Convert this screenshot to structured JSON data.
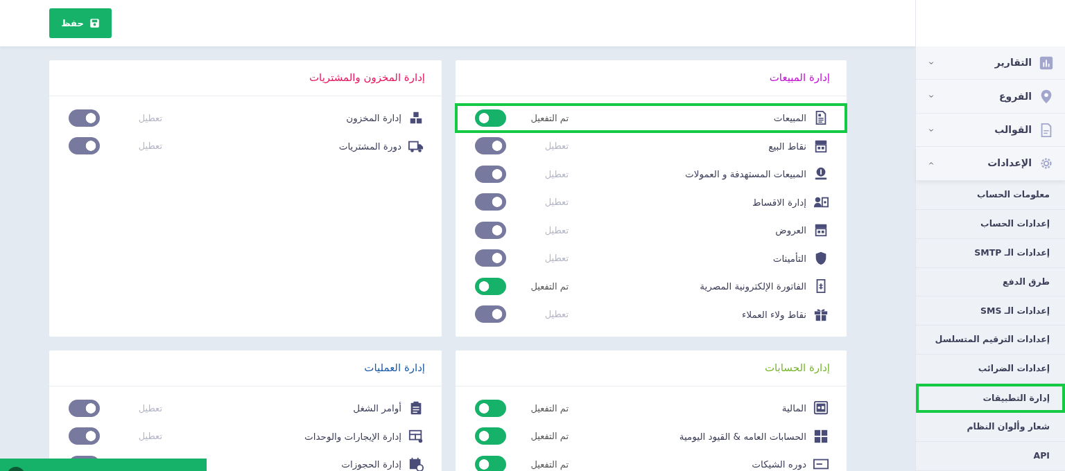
{
  "toolbar": {
    "save_button": "حفظ"
  },
  "sections": [
    {
      "title": "إدارة المبيعات",
      "color": "#c50fd6",
      "rows": [
        {
          "label": "المبيعات",
          "status": "تم التفعيل",
          "on": true,
          "highlighted": true
        },
        {
          "label": "نقاط البيع",
          "status": "تعطيل",
          "on": false,
          "highlighted": false
        },
        {
          "label": "المبيعات المستهدفة و العمولات",
          "status": "تعطيل",
          "on": false,
          "highlighted": false
        },
        {
          "label": "إدارة الاقساط",
          "status": "تعطيل",
          "on": false,
          "highlighted": false
        },
        {
          "label": "العروض",
          "status": "تعطيل",
          "on": false,
          "highlighted": false
        },
        {
          "label": "التأمينات",
          "status": "تعطيل",
          "on": false,
          "highlighted": false
        },
        {
          "label": "الفاتورة الإلكترونية المصرية",
          "status": "تم التفعيل",
          "on": true,
          "highlighted": false
        },
        {
          "label": "نقاط ولاء العملاء",
          "status": "تعطيل",
          "on": false,
          "highlighted": false
        }
      ]
    },
    {
      "title": "إدارة المخزون والمشتريات",
      "color": "#e8175d",
      "rows": [
        {
          "label": "إدارة المخزون",
          "status": "تعطيل",
          "on": false,
          "highlighted": false
        },
        {
          "label": "دورة المشتريات",
          "status": "تعطيل",
          "on": false,
          "highlighted": false
        }
      ]
    },
    {
      "title": "إدارة الحسابات",
      "color": "#7ab62f",
      "rows": [
        {
          "label": "المالية",
          "status": "تم التفعيل",
          "on": true,
          "highlighted": false
        },
        {
          "label": "الحسابات العامه & القيود اليومية",
          "status": "تم التفعيل",
          "on": true,
          "highlighted": false
        },
        {
          "label": "دوره الشيكات",
          "status": "تم التفعيل",
          "on": true,
          "highlighted": false
        }
      ]
    },
    {
      "title": "إدارة العمليات",
      "color": "#1c5cab",
      "rows": [
        {
          "label": "أوامر الشغل",
          "status": "تعطيل",
          "on": false,
          "highlighted": false
        },
        {
          "label": "إدارة الإيجارات والوحدات",
          "status": "تعطيل",
          "on": false,
          "highlighted": false
        },
        {
          "label": "إدارة الحجوزات",
          "on": false,
          "highlighted": false
        }
      ]
    }
  ],
  "sidebar": {
    "items": [
      {
        "label": "التقارير",
        "expanded": false
      },
      {
        "label": "الفروع",
        "expanded": false
      },
      {
        "label": "القوالب",
        "expanded": false
      },
      {
        "label": "الإعدادات",
        "expanded": true,
        "children": [
          {
            "label": "معلومات الحساب",
            "highlighted": false
          },
          {
            "label": "إعدادات الحساب",
            "highlighted": false
          },
          {
            "label": "إعدادات الـ SMTP",
            "highlighted": false
          },
          {
            "label": "طرق الدفع",
            "highlighted": false
          },
          {
            "label": "إعدادات الـ SMS",
            "highlighted": false
          },
          {
            "label": "إعدادات الترقيم المتسلسل",
            "highlighted": false
          },
          {
            "label": "إعدادات الضرائب",
            "highlighted": false
          },
          {
            "label": "إدارة التطبيقات",
            "highlighted": true
          },
          {
            "label": "شعار وألوان النظام",
            "highlighted": false
          },
          {
            "label": "API",
            "highlighted": false
          }
        ]
      }
    ]
  },
  "toast": {
    "visible": true
  }
}
